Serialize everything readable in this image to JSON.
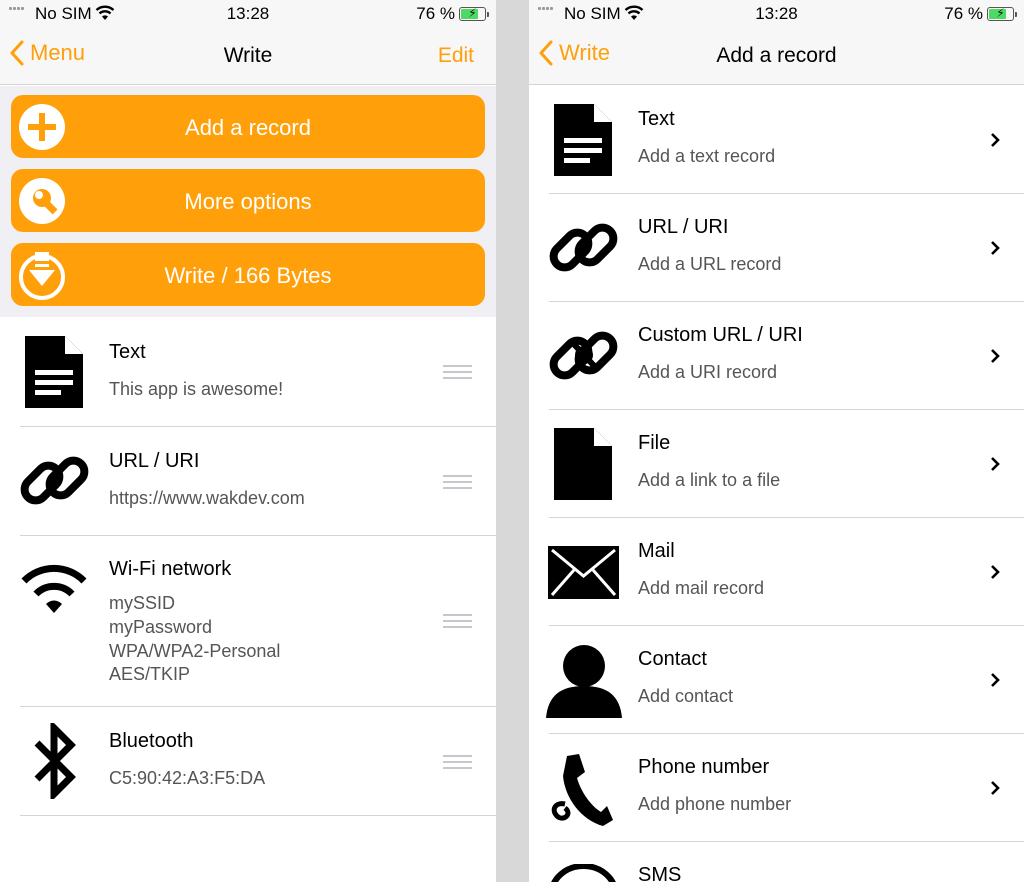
{
  "status": {
    "left": {
      "carrier": "No SIM",
      "time": "13:28",
      "battery": "76 %"
    },
    "right": {
      "carrier": "No SIM",
      "time": "13:28",
      "battery": "76 %"
    },
    "battery_level_fraction": 0.76,
    "battery_color": "#4cd964"
  },
  "colors": {
    "accent": "#ff9f0a",
    "button_area_bg": "#efeff4",
    "divider_bg": "#d8d8d8"
  },
  "left": {
    "nav": {
      "back": "Menu",
      "title": "Write",
      "edit": "Edit"
    },
    "buttons": [
      {
        "label": "Add a record",
        "icon": "plus-circle-icon"
      },
      {
        "label": "More options",
        "icon": "wrench-icon"
      },
      {
        "label": "Write / 166 Bytes",
        "icon": "download-icon"
      }
    ],
    "records": [
      {
        "title": "Text",
        "lines": [
          "This app is awesome!"
        ],
        "icon": "document-icon"
      },
      {
        "title": "URL / URI",
        "lines": [
          "https://www.wakdev.com"
        ],
        "icon": "link-icon"
      },
      {
        "title": "Wi-Fi network",
        "lines": [
          "mySSID",
          "myPassword",
          "WPA/WPA2-Personal",
          "AES/TKIP"
        ],
        "icon": "wifi-icon"
      },
      {
        "title": "Bluetooth",
        "lines": [
          "C5:90:42:A3:F5:DA"
        ],
        "icon": "bluetooth-icon"
      }
    ]
  },
  "right": {
    "nav": {
      "back": "Write",
      "title": "Add a record"
    },
    "types": [
      {
        "title": "Text",
        "subtitle": "Add a text record",
        "icon": "document-icon"
      },
      {
        "title": "URL / URI",
        "subtitle": "Add a URL record",
        "icon": "link-icon"
      },
      {
        "title": "Custom URL / URI",
        "subtitle": "Add a URI record",
        "icon": "custom-link-icon"
      },
      {
        "title": "File",
        "subtitle": "Add a link to a file",
        "icon": "file-icon"
      },
      {
        "title": "Mail",
        "subtitle": "Add mail record",
        "icon": "mail-icon"
      },
      {
        "title": "Contact",
        "subtitle": "Add contact",
        "icon": "contact-icon"
      },
      {
        "title": "Phone number",
        "subtitle": "Add phone number",
        "icon": "phone-icon"
      },
      {
        "title": "SMS",
        "subtitle": "",
        "icon": "sms-icon"
      }
    ]
  }
}
